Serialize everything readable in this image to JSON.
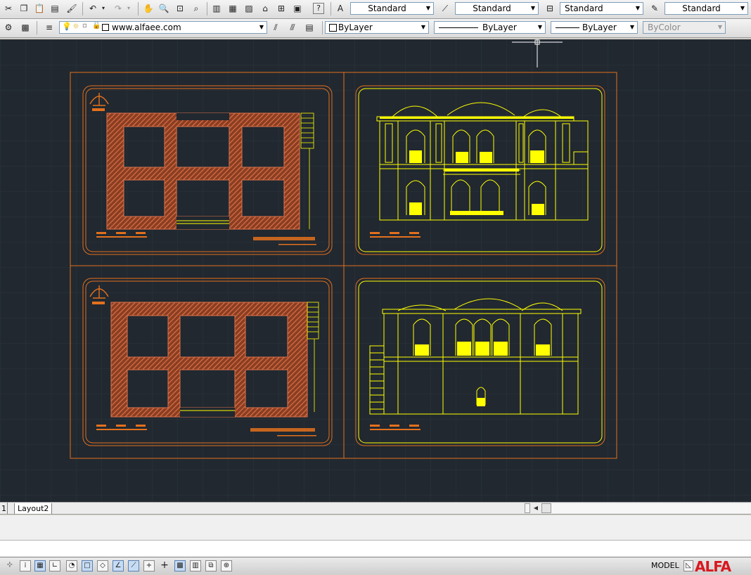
{
  "toolbar_top": {
    "text_style": "Standard",
    "dim_style": "Standard",
    "table_style": "Standard",
    "multileader_style": "Standard"
  },
  "toolbar_layers": {
    "layer_name": "www.alfaee.com",
    "color": "ByLayer",
    "linetype": "ByLayer",
    "lineweight": "ByLayer",
    "plot_style": "ByColor"
  },
  "tabs": {
    "first_tab": "1",
    "layout2": "Layout2"
  },
  "status": {
    "model_label": "MODEL",
    "brand": "ALFA"
  },
  "colors": {
    "canvas": "#212830",
    "frame": "#e3701c",
    "elevation": "#ffff00",
    "hatch": "#d9663a"
  }
}
